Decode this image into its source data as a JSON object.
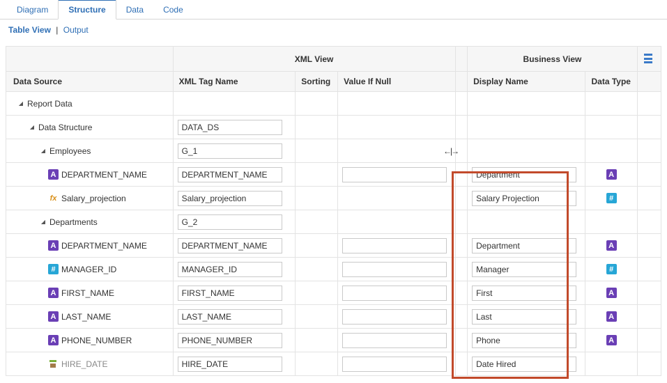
{
  "tabs": {
    "diagram": "Diagram",
    "structure": "Structure",
    "data": "Data",
    "code": "Code"
  },
  "subtabs": {
    "tableview": "Table View",
    "output": "Output"
  },
  "headers": {
    "xmlview": "XML View",
    "bizview": "Business View",
    "dsource": "Data Source",
    "xmltag": "XML Tag Name",
    "sorting": "Sorting",
    "valnull": "Value If Null",
    "dispname": "Display Name",
    "dtype": "Data Type"
  },
  "rows": [
    {
      "indent": 0,
      "tw": "▢",
      "icon": "",
      "label": "Report Data",
      "xml": "",
      "null": null,
      "disp": null,
      "dt": ""
    },
    {
      "indent": 1,
      "tw": "▢",
      "icon": "",
      "label": "Data Structure",
      "xml": "DATA_DS",
      "null": null,
      "disp": null,
      "dt": ""
    },
    {
      "indent": 2,
      "tw": "▢",
      "icon": "",
      "label": "Employees",
      "xml": "G_1",
      "null": null,
      "disp": null,
      "dt": ""
    },
    {
      "indent": 3,
      "tw": "",
      "icon": "A",
      "label": "DEPARTMENT_NAME",
      "xml": "DEPARTMENT_NAME",
      "null": "",
      "disp": "Department",
      "dt": "A"
    },
    {
      "indent": 3,
      "tw": "",
      "icon": "fx",
      "label": "Salary_projection",
      "xml": "Salary_projection",
      "null": null,
      "disp": "Salary Projection",
      "dt": "N"
    },
    {
      "indent": 2,
      "tw": "▢",
      "icon": "",
      "label": "Departments",
      "xml": "G_2",
      "null": null,
      "disp": null,
      "dt": ""
    },
    {
      "indent": 3,
      "tw": "",
      "icon": "A",
      "label": "DEPARTMENT_NAME",
      "xml": "DEPARTMENT_NAME",
      "null": "",
      "disp": "Department",
      "dt": "A"
    },
    {
      "indent": 3,
      "tw": "",
      "icon": "N",
      "label": "MANAGER_ID",
      "xml": "MANAGER_ID",
      "null": "",
      "disp": "Manager",
      "dt": "N"
    },
    {
      "indent": 3,
      "tw": "",
      "icon": "A",
      "label": "FIRST_NAME",
      "xml": "FIRST_NAME",
      "null": "",
      "disp": "First",
      "dt": "A"
    },
    {
      "indent": 3,
      "tw": "",
      "icon": "A",
      "label": "LAST_NAME",
      "xml": "LAST_NAME",
      "null": "",
      "disp": "Last",
      "dt": "A"
    },
    {
      "indent": 3,
      "tw": "",
      "icon": "A",
      "label": "PHONE_NUMBER",
      "xml": "PHONE_NUMBER",
      "null": "",
      "disp": "Phone",
      "dt": "A"
    },
    {
      "indent": 3,
      "tw": "",
      "icon": "date",
      "label": "HIRE_DATE",
      "xml": "HIRE_DATE",
      "null": "",
      "disp": "Date Hired",
      "dt": ""
    }
  ],
  "icons": {
    "A": "A",
    "N": "#",
    "fx": "fx"
  },
  "resize_glyph": "↔"
}
